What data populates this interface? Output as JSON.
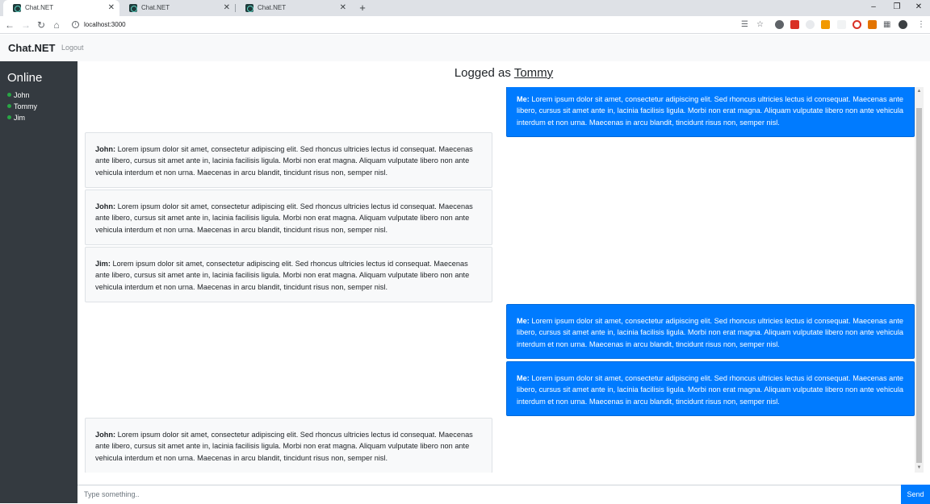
{
  "browser": {
    "tabs": [
      {
        "title": "Chat.NET"
      },
      {
        "title": "Chat.NET"
      },
      {
        "title": "Chat.NET"
      }
    ],
    "url": "localhost:3000"
  },
  "navbar": {
    "brand": "Chat.NET",
    "logout": "Logout"
  },
  "sidebar": {
    "title": "Online",
    "users": [
      {
        "name": "John",
        "status_color": "#28a745"
      },
      {
        "name": "Tommy",
        "status_color": "#28a745"
      },
      {
        "name": "Jim",
        "status_color": "#28a745"
      }
    ]
  },
  "header": {
    "prefix": "Logged as",
    "username": "Tommy"
  },
  "messages": [
    {
      "author": "Me:",
      "mine": true,
      "text": "Lorem ipsum dolor sit amet, consectetur adipiscing elit. Sed rhoncus ultricies lectus id consequat. Maecenas ante libero, cursus sit amet ante in, lacinia facilisis ligula. Morbi non erat magna. Aliquam vulputate libero non ante vehicula interdum et non urna. Maecenas in arcu blandit, tincidunt risus non, semper nisl."
    },
    {
      "author": "John:",
      "mine": false,
      "text": "Lorem ipsum dolor sit amet, consectetur adipiscing elit. Sed rhoncus ultricies lectus id consequat. Maecenas ante libero, cursus sit amet ante in, lacinia facilisis ligula. Morbi non erat magna. Aliquam vulputate libero non ante vehicula interdum et non urna. Maecenas in arcu blandit, tincidunt risus non, semper nisl."
    },
    {
      "author": "John:",
      "mine": false,
      "text": "Lorem ipsum dolor sit amet, consectetur adipiscing elit. Sed rhoncus ultricies lectus id consequat. Maecenas ante libero, cursus sit amet ante in, lacinia facilisis ligula. Morbi non erat magna. Aliquam vulputate libero non ante vehicula interdum et non urna. Maecenas in arcu blandit, tincidunt risus non, semper nisl."
    },
    {
      "author": "Jim:",
      "mine": false,
      "text": "Lorem ipsum dolor sit amet, consectetur adipiscing elit. Sed rhoncus ultricies lectus id consequat. Maecenas ante libero, cursus sit amet ante in, lacinia facilisis ligula. Morbi non erat magna. Aliquam vulputate libero non ante vehicula interdum et non urna. Maecenas in arcu blandit, tincidunt risus non, semper nisl."
    },
    {
      "author": "Me:",
      "mine": true,
      "text": "Lorem ipsum dolor sit amet, consectetur adipiscing elit. Sed rhoncus ultricies lectus id consequat. Maecenas ante libero, cursus sit amet ante in, lacinia facilisis ligula. Morbi non erat magna. Aliquam vulputate libero non ante vehicula interdum et non urna. Maecenas in arcu blandit, tincidunt risus non, semper nisl."
    },
    {
      "author": "Me:",
      "mine": true,
      "text": "Lorem ipsum dolor sit amet, consectetur adipiscing elit. Sed rhoncus ultricies lectus id consequat. Maecenas ante libero, cursus sit amet ante in, lacinia facilisis ligula. Morbi non erat magna. Aliquam vulputate libero non ante vehicula interdum et non urna. Maecenas in arcu blandit, tincidunt risus non, semper nisl."
    },
    {
      "author": "John:",
      "mine": false,
      "text": "Lorem ipsum dolor sit amet, consectetur adipiscing elit. Sed rhoncus ultricies lectus id consequat. Maecenas ante libero, cursus sit amet ante in, lacinia facilisis ligula. Morbi non erat magna. Aliquam vulputate libero non ante vehicula interdum et non urna. Maecenas in arcu blandit, tincidunt risus non, semper nisl."
    }
  ],
  "composer": {
    "placeholder": "Type something..",
    "value": "",
    "send_label": "Send"
  },
  "colors": {
    "sidebar_bg": "#343a40",
    "mine_bubble": "#007bff",
    "other_bubble": "#f8f9fa",
    "online_dot": "#28a745"
  }
}
